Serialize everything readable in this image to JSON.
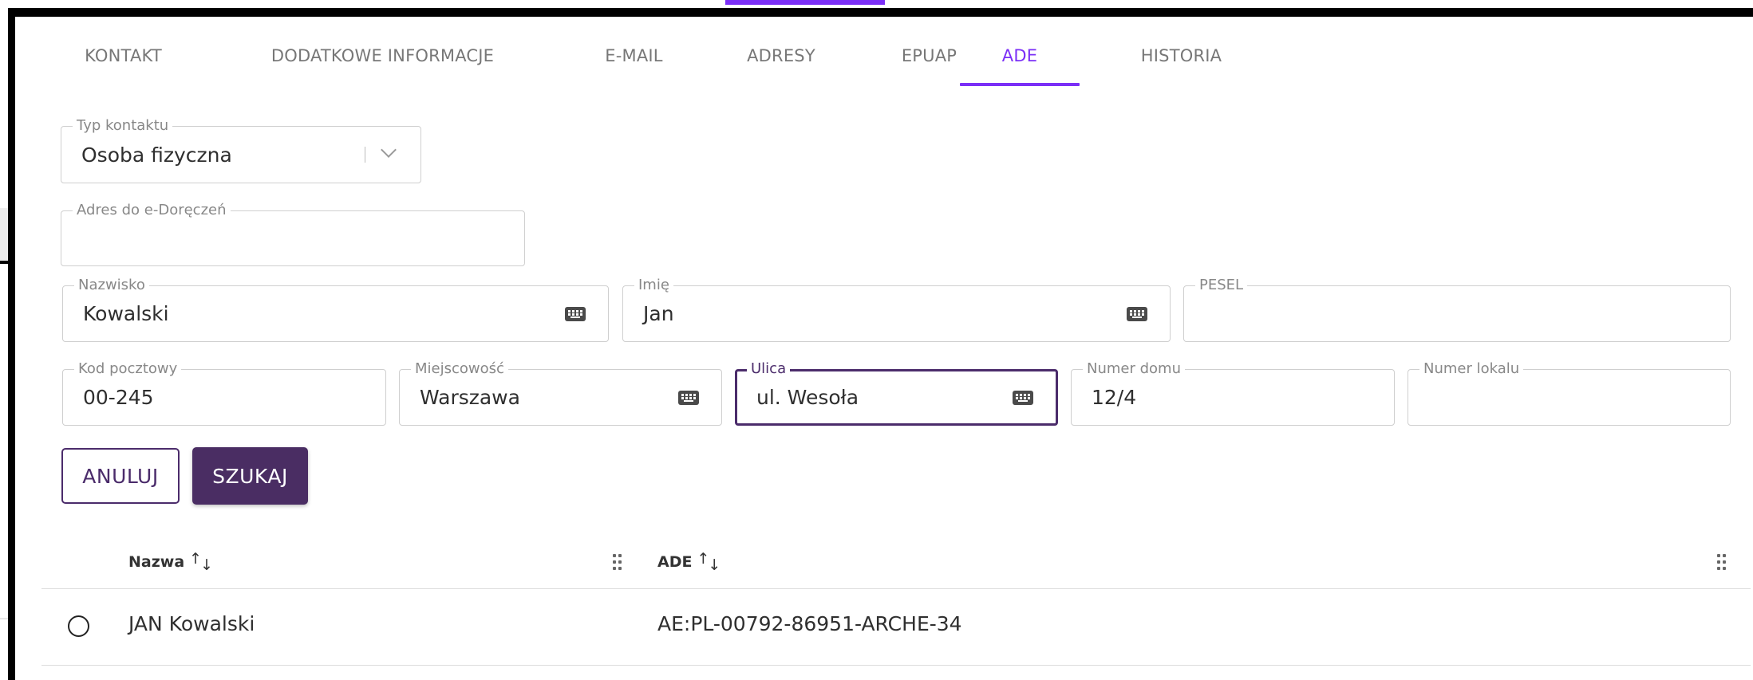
{
  "tabs": [
    {
      "label": "KONTAKT",
      "active": false
    },
    {
      "label": "DODATKOWE INFORMACJE",
      "active": false
    },
    {
      "label": "E-MAIL",
      "active": false
    },
    {
      "label": "ADRESY",
      "active": false
    },
    {
      "label": "EPUAP",
      "active": false
    },
    {
      "label": "ADE",
      "active": true
    },
    {
      "label": "HISTORIA",
      "active": false
    }
  ],
  "form": {
    "contact_type": {
      "label": "Typ kontaktu",
      "value": "Osoba fizyczna"
    },
    "edelivery_address": {
      "label": "Adres do e-Doręczeń",
      "value": ""
    },
    "surname": {
      "label": "Nazwisko",
      "value": "Kowalski"
    },
    "first_name": {
      "label": "Imię",
      "value": "Jan"
    },
    "pesel": {
      "label": "PESEL",
      "value": ""
    },
    "postal_code": {
      "label": "Kod pocztowy",
      "value": "00-245"
    },
    "city": {
      "label": "Miejscowość",
      "value": "Warszawa"
    },
    "street": {
      "label": "Ulica",
      "value": "ul. Wesoła"
    },
    "house_number": {
      "label": "Numer domu",
      "value": "12/4"
    },
    "apartment_number": {
      "label": "Numer lokalu",
      "value": ""
    }
  },
  "buttons": {
    "cancel": "ANULUJ",
    "search": "SZUKAJ"
  },
  "table": {
    "columns": [
      "Nazwa",
      "ADE"
    ],
    "rows": [
      {
        "name": "JAN Kowalski",
        "ade": "AE:PL-00792-86951-ARCHE-34",
        "selected": false
      }
    ]
  },
  "colors": {
    "accent": "#7b2ff7",
    "primary_button": "#4a2d63",
    "focused_border": "#4b2c6b"
  },
  "icons": {
    "keyboard": "keyboard-icon",
    "sort": "sort-icon",
    "drag": "drag-handle-icon",
    "chevron": "chevron-down-icon"
  }
}
